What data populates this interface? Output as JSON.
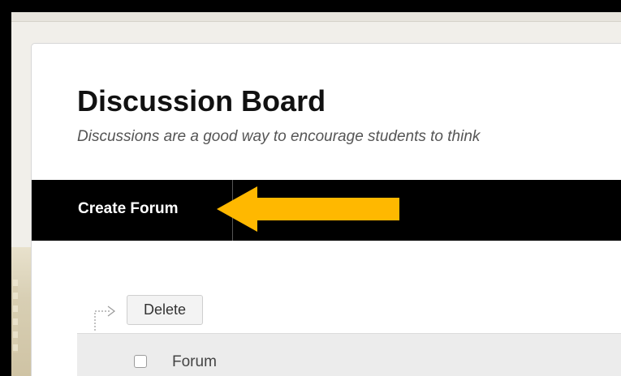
{
  "page": {
    "title": "Discussion Board",
    "description": "Discussions are a good way to encourage students to think"
  },
  "action_bar": {
    "create_forum_label": "Create Forum"
  },
  "toolbar": {
    "delete_label": "Delete"
  },
  "table": {
    "columns": [
      "Forum"
    ]
  },
  "colors": {
    "action_bar_bg": "#000000",
    "callout_arrow": "#FFB800"
  }
}
